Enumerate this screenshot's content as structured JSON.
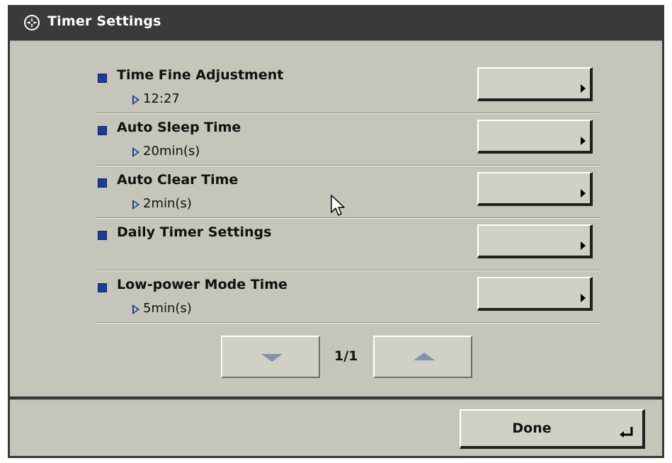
{
  "window": {
    "title": "Timer Settings"
  },
  "settings": [
    {
      "label": "Time Fine Adjustment",
      "value": "12:27"
    },
    {
      "label": "Auto Sleep Time",
      "value": "20min(s)"
    },
    {
      "label": "Auto Clear Time",
      "value": "2min(s)"
    },
    {
      "label": "Daily Timer Settings",
      "value": ""
    },
    {
      "label": "Low-power Mode Time",
      "value": "5min(s)"
    }
  ],
  "pagination": {
    "page": "1/1"
  },
  "footer": {
    "done_label": "Done"
  },
  "colors": {
    "panel": "#c5c5b9",
    "titlebar": "#3a3a3a",
    "bullet": "#1c3c96",
    "button": "#d0d0c5"
  },
  "icons": {
    "title": "gear-star-icon",
    "next": "triangle-down-icon",
    "prev": "triangle-up-icon",
    "done": "enter-return-icon"
  }
}
